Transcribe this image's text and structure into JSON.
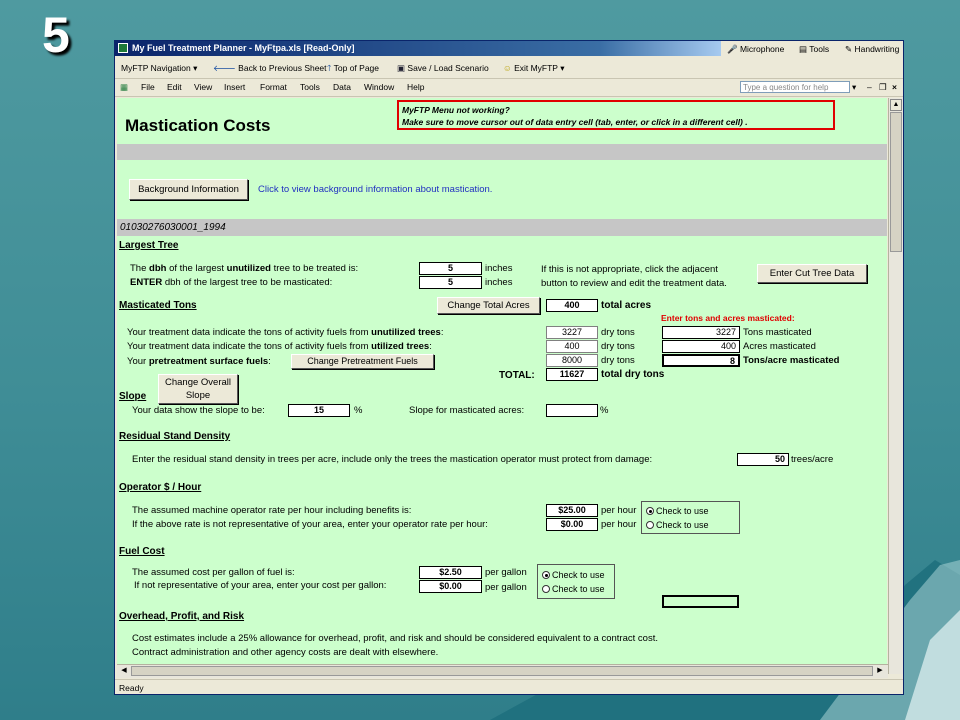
{
  "slide": {
    "number": "5"
  },
  "window": {
    "title": "My Fuel Treatment Planner - MyFtpa.xls  [Read-Only]"
  },
  "language_bar": {
    "microphone": "Microphone",
    "tools": "Tools",
    "handwriting": "Handwriting"
  },
  "toolbar": {
    "myftp_nav": "MyFTP Navigation",
    "back": "Back to Previous Sheet",
    "top": "Top of Page",
    "save_load": "Save / Load Scenario",
    "exit": "Exit MyFTP"
  },
  "menu": {
    "items": [
      "File",
      "Edit",
      "View",
      "Insert",
      "Format",
      "Tools",
      "Data",
      "Window",
      "Help"
    ]
  },
  "help_box": {
    "placeholder": "Type a question for help"
  },
  "sheet": {
    "title": "Mastication Costs",
    "notice_line1": "MyFTP Menu not working?",
    "notice_line2": "Make sure to move cursor out of data entry cell (tab, enter, or click in a different cell) .",
    "bg_button": "Background Information",
    "bg_link": "Click to view background information about mastication.",
    "scenario_id": "01030276030001_1994",
    "largest_tree": {
      "heading": "Largest Tree",
      "line1_pre": "The ",
      "line1_b1": "dbh",
      "line1_mid": " of the largest ",
      "line1_b2": "unutilized",
      "line1_post": " tree to be treated is:",
      "line2_b": "ENTER",
      "line2_post": " dbh of the largest tree to be masticated:",
      "value1": "5",
      "value2": "5",
      "unit1": "inches",
      "unit2": "inches",
      "note1": "If this is not appropriate, click the adjacent",
      "note2": "button to review and edit the treatment data.",
      "cut_button": "Enter Cut Tree Data"
    },
    "tons": {
      "heading": "Masticated Tons",
      "change_acres_button": "Change Total Acres",
      "total_acres_value": "400",
      "total_acres_label": "total acres",
      "enter_label": "Enter tons and acres masticated:",
      "l1_pre": "Your treatment data indicate the tons of activity fuels from ",
      "l1_b": "unutilized trees",
      "l1_post": ":",
      "l2_pre": "Your treatment data indicate the tons of activity fuels from ",
      "l2_b": "utilized trees",
      "l2_post": ":",
      "l3_pre": "Your ",
      "l3_b": "pretreatment surface fuels",
      "l3_post": ":",
      "pretreat_button": "Change Pretreatment Fuels",
      "v1": "3227",
      "v2": "400",
      "v3": "8000",
      "unit": "dry tons",
      "total_label": "TOTAL:",
      "total_value": "11627",
      "total_unit": "total dry tons",
      "r1": "3227",
      "r2": "400",
      "r3": "8",
      "r1_label": "Tons masticated",
      "r2_label": "Acres masticated",
      "r3_label": "Tons/acre masticated"
    },
    "slope": {
      "heading": "Slope",
      "button_line1": "Change Overall",
      "button_line2": "Slope",
      "text": "Your data show the slope to be:",
      "value": "15",
      "pct": "%",
      "masticated_label": "Slope for masticated acres:",
      "pct2": "%"
    },
    "residual": {
      "heading": "Residual Stand Density",
      "text": "Enter the residual stand density in trees per acre, include only the trees the mastication operator must protect from damage:",
      "value": "50",
      "unit": "trees/acre"
    },
    "operator": {
      "heading": "Operator $ / Hour",
      "l1": "The assumed machine operator rate per hour including benefits is:",
      "l2": "If the above rate is not representative of your area, enter your operator rate per hour:",
      "v1": "$25.00",
      "v2": "$0.00",
      "unit": "per hour",
      "opt1": "Check to use",
      "opt2": "Check to use"
    },
    "fuel": {
      "heading": "Fuel Cost",
      "l1": "The assumed cost per gallon of fuel is:",
      "l2": "If not representative of your area, enter your cost per gallon:",
      "v1": "$2.50",
      "v2": "$0.00",
      "unit": "per gallon",
      "opt1": "Check to use",
      "opt2": "Check to use"
    },
    "overhead": {
      "heading": "Overhead, Profit, and Risk",
      "l1": "Cost estimates include a 25% allowance for overhead, profit, and risk and should be considered equivalent to a contract cost.",
      "l2": "Contract administration and other agency costs are dealt with elsewhere."
    }
  },
  "status": {
    "text": "Ready"
  }
}
